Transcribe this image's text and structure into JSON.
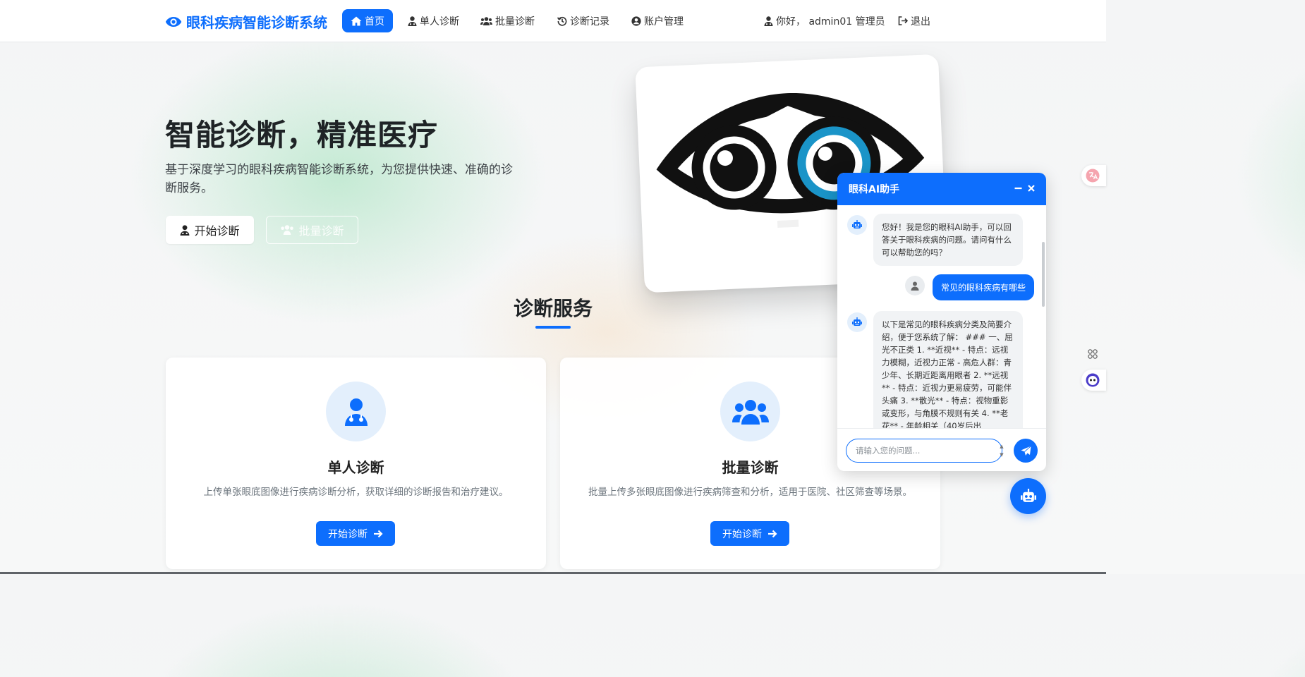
{
  "brand": {
    "name": "眼科疾病智能诊断系统"
  },
  "nav": {
    "items": [
      {
        "label": "首页",
        "icon": "home-icon",
        "active": true
      },
      {
        "label": "单人诊断",
        "icon": "user-md-icon"
      },
      {
        "label": "批量诊断",
        "icon": "users-icon"
      },
      {
        "label": "诊断记录",
        "icon": "history-icon"
      },
      {
        "label": "账户管理",
        "icon": "user-circle-icon"
      }
    ],
    "greeting": "你好， admin01 管理员",
    "logout": "退出"
  },
  "hero": {
    "title": "智能诊断，精准医疗",
    "subtitle": "基于深度学习的眼科疾病智能诊断系统，为您提供快速、准确的诊断服务。",
    "primary_button": "开始诊断",
    "secondary_button": "批量诊断"
  },
  "services": {
    "title": "诊断服务",
    "cards": [
      {
        "title": "单人诊断",
        "description": "上传单张眼底图像进行疾病诊断分析，获取详细的诊断报告和治疗建议。",
        "button": "开始诊断",
        "icon": "user-md-icon"
      },
      {
        "title": "批量诊断",
        "description": "批量上传多张眼底图像进行疾病筛查和分析，适用于医院、社区筛查等场景。",
        "button": "开始诊断",
        "icon": "users-icon"
      }
    ]
  },
  "chat": {
    "title": "眼科AI助手",
    "messages": [
      {
        "role": "bot",
        "text": "您好！我是您的眼科AI助手，可以回答关于眼科疾病的问题。请问有什么可以帮助您的吗？"
      },
      {
        "role": "user",
        "text": "常见的眼科疾病有哪些"
      },
      {
        "role": "bot",
        "text": "以下是常见的眼科疾病分类及简要介绍，便于您系统了解： ### 一、屈光不正类 1. **近视** - 特点：远视力模糊，近视力正常 - 高危人群：青少年、长期近距离用眼者 2. **远视** - 特点：近视力更易疲劳，可能伴头痛 3. **散光** - 特点：视物重影或变形，与角膜不规则有关 4. **老花** - 年龄相关（40岁后出"
      }
    ],
    "input_placeholder": "请输入您的问题..."
  },
  "colors": {
    "primary": "#0d6efd",
    "primary_light": "#e3effc",
    "text_dark": "#1f2326",
    "text_muted": "#6c757d"
  }
}
